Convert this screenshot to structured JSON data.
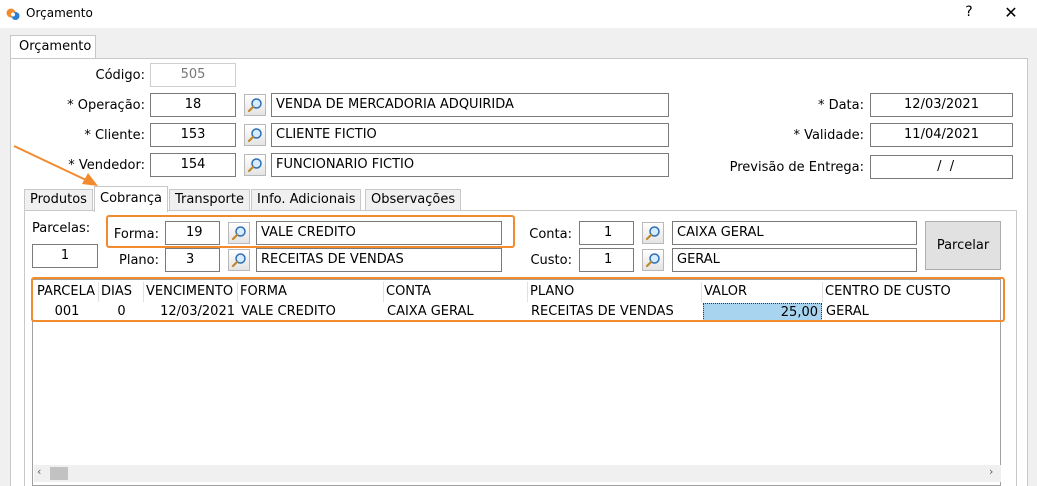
{
  "window": {
    "title": "Orçamento",
    "help": "?",
    "close": "✕"
  },
  "outer_tab": "Orçamento",
  "header": {
    "codigo_label": "Código:",
    "codigo_value": "505",
    "operacao_label": "* Operação:",
    "operacao_code": "18",
    "operacao_desc": "VENDA DE MERCADORIA ADQUIRIDA",
    "cliente_label": "* Cliente:",
    "cliente_code": "153",
    "cliente_desc": "CLIENTE FICTIO",
    "vendedor_label": "* Vendedor:",
    "vendedor_code": "154",
    "vendedor_desc": "FUNCIONARIO FICTIO",
    "data_label": "* Data:",
    "data_value": "12/03/2021",
    "validade_label": "* Validade:",
    "validade_value": "11/04/2021",
    "previsao_label": "Previsão de Entrega:",
    "previsao_value": "  /  /"
  },
  "tabs": [
    "Produtos",
    "Cobrança",
    "Transporte",
    "Info. Adicionais",
    "Observações"
  ],
  "cobranca": {
    "parcelas_label": "Parcelas:",
    "parcelas_value": "1",
    "forma_label": "Forma:",
    "forma_code": "19",
    "forma_desc": "VALE CREDITO",
    "plano_label": "Plano:",
    "plano_code": "3",
    "plano_desc": "RECEITAS DE VENDAS",
    "conta_label": "Conta:",
    "conta_code": "1",
    "conta_desc": "CAIXA GERAL",
    "custo_label": "Custo:",
    "custo_code": "1",
    "custo_desc": "GERAL",
    "parcelar_label": "Parcelar"
  },
  "grid": {
    "columns": [
      "PARCELA",
      "DIAS",
      "VENCIMENTO",
      "FORMA",
      "CONTA",
      "PLANO",
      "VALOR",
      "CENTRO DE CUSTO"
    ],
    "rows": [
      [
        "001",
        "0",
        "12/03/2021",
        "VALE CREDITO",
        "CAIXA GERAL",
        "RECEITAS DE VENDAS",
        "25,00",
        "GERAL"
      ]
    ]
  },
  "colors": {
    "highlight": "#f28a2e",
    "selected_cell": "#a8d4f0"
  },
  "icons": {
    "app": "app-logo-icon",
    "lookup": "magnifier-icon"
  }
}
